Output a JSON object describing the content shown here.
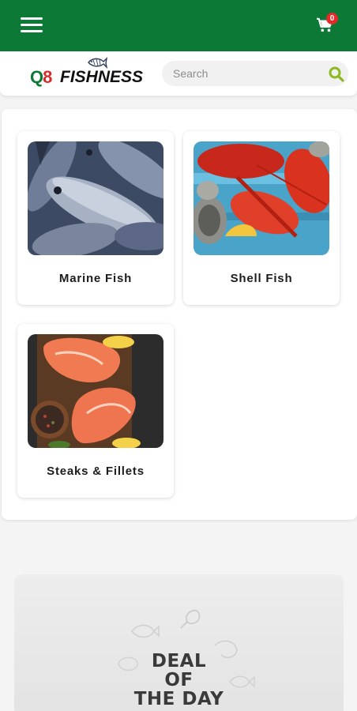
{
  "header": {
    "menu_icon": "hamburger-menu-icon",
    "cart_icon": "shopping-cart-icon",
    "cart_count": "0",
    "brand_color": "#0c7a36"
  },
  "logo": {
    "prefix_q": "Q",
    "prefix_8": "8",
    "name": "FISHNESS"
  },
  "search": {
    "placeholder": "Search",
    "value": "",
    "icon": "search-icon"
  },
  "categories": [
    {
      "label": "Marine Fish",
      "image": "tuna-fish-image"
    },
    {
      "label": "Shell Fish",
      "image": "lobster-oyster-image"
    },
    {
      "label": "Steaks & Fillets",
      "image": "salmon-steak-image"
    }
  ],
  "deal": {
    "line1": "DEAL",
    "line2": "OF",
    "line3": "THE DAY"
  }
}
